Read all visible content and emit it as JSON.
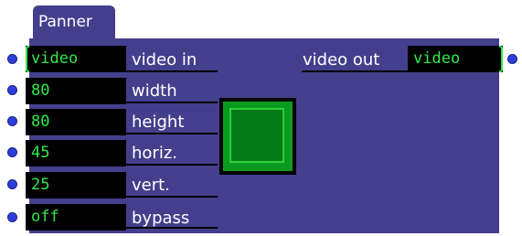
{
  "actor": {
    "title": "Panner",
    "inputs": [
      {
        "value": "video",
        "label": "video in"
      },
      {
        "value": "80",
        "label": "width"
      },
      {
        "value": "80",
        "label": "height"
      },
      {
        "value": "45",
        "label": "horiz."
      },
      {
        "value": "25",
        "label": "vert."
      },
      {
        "value": "off",
        "label": "bypass"
      }
    ],
    "output": {
      "label": "video out",
      "value": "video"
    }
  },
  "colors": {
    "panel": "#443f8c",
    "field_bg": "#000000",
    "field_text": "#31e84a",
    "port": "#2d3fd8",
    "preview": "#0a9a1f"
  }
}
